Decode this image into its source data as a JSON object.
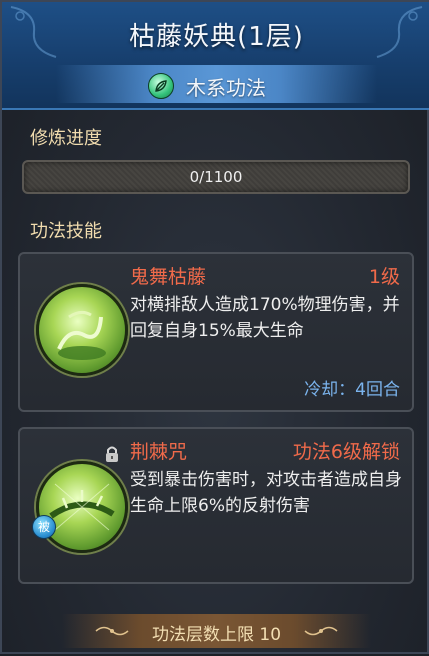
{
  "header": {
    "title": "枯藤妖典(1层)",
    "type_label": "木系功法",
    "type_icon": "leaf-icon"
  },
  "training": {
    "section_title": "修炼进度",
    "progress_text": "0/1100",
    "progress_fraction": 0
  },
  "skills_section": {
    "title": "功法技能",
    "skills": [
      {
        "name": "鬼舞枯藤",
        "level": "1级",
        "description": "对横排敌人造成170%物理伤害，并回复自身15%最大生命",
        "cooldown": "冷却：4回合",
        "icon": "vine-skill-icon"
      },
      {
        "name": "荆棘咒",
        "unlock": "功法6级解锁",
        "description": "受到暴击伤害时，对攻击者造成自身生命上限6%的反射伤害",
        "passive_badge": "被",
        "icon": "thorn-skill-icon",
        "locked": true
      }
    ]
  },
  "footer": {
    "text": "功法层数上限 10"
  },
  "colors": {
    "header_blue": "#1e4f86",
    "skill_name_red": "#f06a4a",
    "cooldown_blue": "#7bb4ee",
    "section_gold": "#f1dcae"
  }
}
